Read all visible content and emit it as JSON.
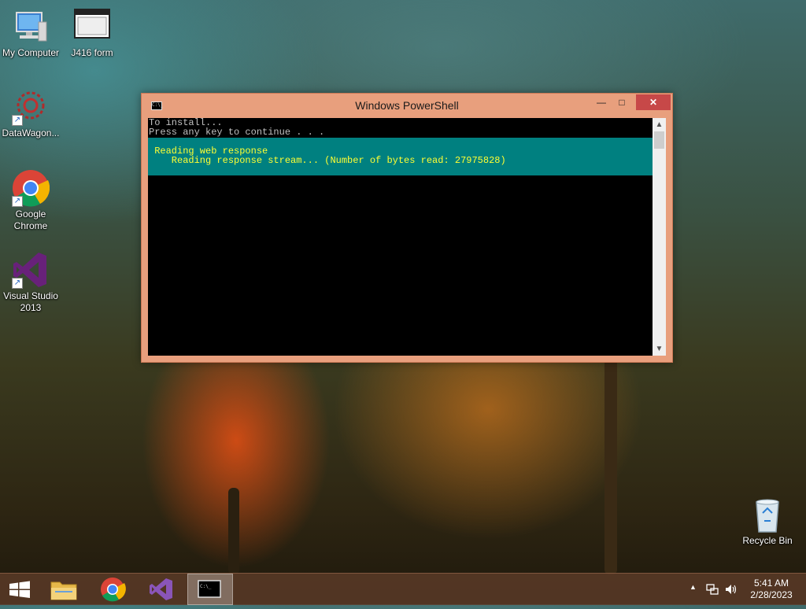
{
  "desktop": {
    "icons": [
      {
        "label": "My Computer",
        "icon": "computer-icon"
      },
      {
        "label": "J416 form",
        "icon": "window-icon"
      },
      {
        "label": "DataWagon...",
        "icon": "datawagon-icon"
      },
      {
        "label_line1": "Google",
        "label_line2": "Chrome",
        "icon": "chrome-icon"
      },
      {
        "label_line1": "Visual Studio",
        "label_line2": "2013",
        "icon": "visual-studio-icon"
      },
      {
        "label": "Recycle Bin",
        "icon": "recycle-bin-icon"
      }
    ]
  },
  "window": {
    "title": "Windows PowerShell",
    "buttons": {
      "minimize": "—",
      "maximize": "□",
      "close": "✕"
    },
    "console_lines": [
      "To install...",
      "Press any key to continue . . ."
    ],
    "progress": {
      "activity": " Reading web response",
      "status": "    Reading response stream... (Number of bytes read: 27975828)"
    }
  },
  "taskbar": {
    "items": [
      "start-button",
      "file-explorer",
      "google-chrome",
      "visual-studio",
      "windows-powershell"
    ],
    "active_item": "windows-powershell",
    "tray": {
      "time": "5:41 AM",
      "date": "2/28/2023"
    }
  },
  "colors": {
    "window_frame": "#e89f7d",
    "close_button": "#c74848",
    "progress_background": "#008080",
    "progress_text": "#ffff33",
    "console_text": "#c0c0c0"
  }
}
